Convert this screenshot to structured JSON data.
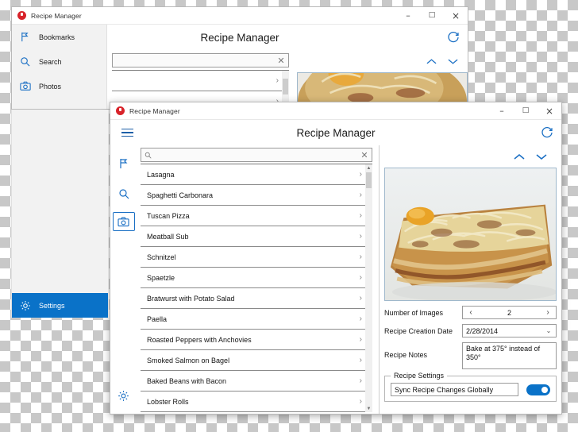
{
  "colors": {
    "accent": "#0a72c8",
    "icon_blue": "#1a6fc4",
    "app_icon_red": "#d8232a",
    "window_bg": "#ffffff",
    "nav_bg": "#f2f2f2"
  },
  "back_window": {
    "titlebar": {
      "app_name": "Recipe Manager",
      "minimize": "–",
      "maximize": "□",
      "close": "×"
    },
    "header": {
      "title": "Recipe Manager",
      "menu_icon": "hamburger-icon",
      "refresh_icon": "refresh-icon"
    },
    "nav_items": [
      {
        "label": "Bookmarks",
        "icon": "flag-icon",
        "selected": false
      },
      {
        "label": "Search",
        "icon": "search-icon",
        "selected": false
      },
      {
        "label": "Photos",
        "icon": "camera-icon",
        "selected": false
      },
      {
        "label": "Settings",
        "icon": "gear-icon",
        "selected": true
      }
    ],
    "search_placeholder": "",
    "search_value": "",
    "clear_label": "✕"
  },
  "front_window": {
    "titlebar": {
      "app_name": "Recipe Manager",
      "minimize": "–",
      "maximize": "□",
      "close": "×"
    },
    "header": {
      "title": "Recipe Manager",
      "menu_icon": "hamburger-icon",
      "refresh_icon": "refresh-icon"
    },
    "rail_icons": [
      {
        "name": "flag-icon",
        "selected": false
      },
      {
        "name": "search-icon",
        "selected": false
      },
      {
        "name": "camera-icon",
        "selected": true
      },
      {
        "name": "gear-icon",
        "selected": false
      }
    ],
    "search": {
      "value": "",
      "placeholder": "",
      "search_icon": "magnifier-icon",
      "clear_icon": "✕"
    },
    "recipes": [
      "Lasagna",
      "Spaghetti Carbonara",
      "Tuscan Pizza",
      "Meatball Sub",
      "Schnitzel",
      "Spaetzle",
      "Bratwurst with Potato Salad",
      "Paella",
      "Roasted Peppers with Anchovies",
      "Smoked Salmon on Bagel",
      "Baked Beans with Bacon",
      "Lobster Rolls"
    ],
    "row_chevron": "›",
    "scrollbar": {
      "up": "▲",
      "down": "▼"
    },
    "detail": {
      "nav_up": "up-chevron-icon",
      "nav_down": "down-chevron-icon",
      "photo_alt": "lasagna-photo",
      "fields": {
        "images_label": "Number of Images",
        "images_value": "2",
        "spin_prev": "‹",
        "spin_next": "›",
        "date_label": "Recipe Creation Date",
        "date_value": "2/28/2014",
        "date_dropdown": "⌄",
        "notes_label": "Recipe Notes",
        "notes_value": "Bake at 375° instead of 350°"
      },
      "settings_group": {
        "title": "Recipe Settings",
        "sync_label": "Sync Recipe Changes Globally",
        "sync_on": true
      }
    }
  }
}
